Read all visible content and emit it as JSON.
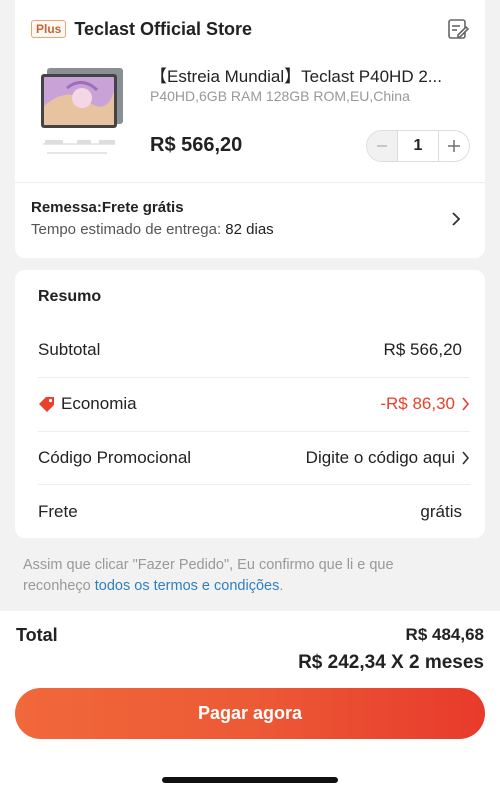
{
  "store": {
    "badge": "Plus",
    "name": "Teclast Official Store",
    "edit_icon": "edit-note-icon"
  },
  "product": {
    "title": "【Estreia Mundial】Teclast P40HD 2...",
    "variant": "P40HD,6GB RAM 128GB ROM,EU,China",
    "price": "R$ 566,20",
    "quantity": "1",
    "minus_icon": "minus-icon",
    "plus_icon": "plus-icon",
    "thumbnail": "tablet-product-image"
  },
  "shipping": {
    "title": "Remessa:Frete grátis",
    "eta_label": "Tempo estimado de entrega:",
    "eta_value": "82 dias"
  },
  "summary": {
    "title": "Resumo",
    "rows": [
      {
        "label": "Subtotal",
        "value": "R$ 566,20"
      },
      {
        "label": "Economia",
        "value": "-R$ 86,30"
      },
      {
        "label": "Código Promocional",
        "value": "Digite o código aqui"
      },
      {
        "label": "Frete",
        "value": "grátis"
      }
    ]
  },
  "terms": {
    "text": "Assim que clicar \"Fazer Pedido\", Eu confirmo que li e que reconheço",
    "link": "todos os termos e condições",
    "end": "."
  },
  "footer": {
    "total_label": "Total",
    "total_value": "R$ 484,68",
    "installment": "R$ 242,34 X 2 meses",
    "pay_button": "Pagar agora"
  },
  "colors": {
    "accent": "#e8412c",
    "button_start": "#f1683a",
    "button_end": "#e83a2b",
    "link": "#2f7fbf"
  }
}
